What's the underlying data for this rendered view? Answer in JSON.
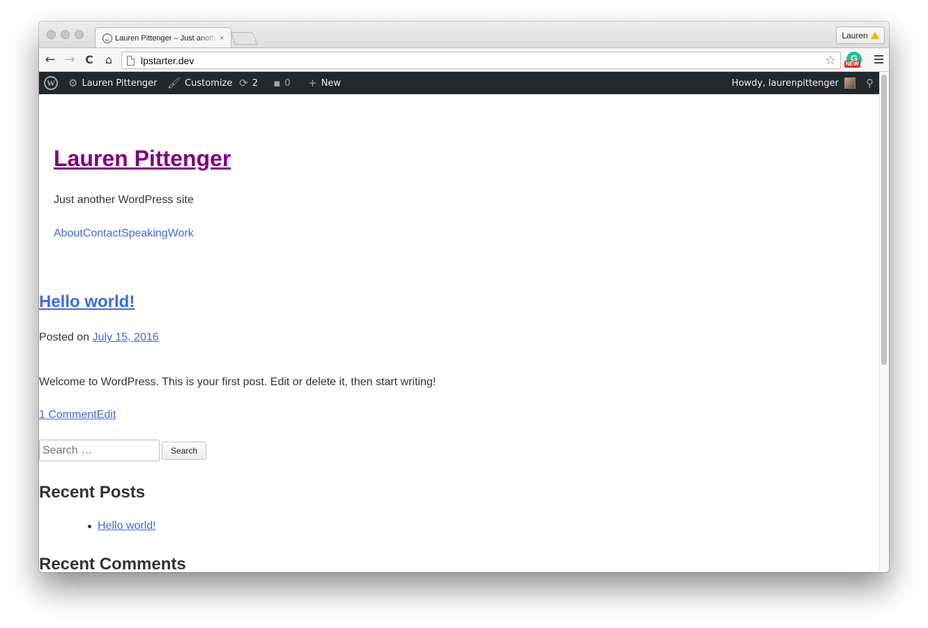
{
  "browser": {
    "tab_title": "Lauren Pittenger – Just another WordPress site",
    "tab_close": "×",
    "profile_name": "Lauren",
    "url": "lpstarter.dev",
    "extension_badge": "NEW",
    "nav": {
      "back": "←",
      "forward": "→",
      "reload": "C",
      "home": "⌂",
      "bookmark_star": "☆"
    }
  },
  "admin_bar": {
    "wp_logo": "W",
    "site_name": "Lauren Pittenger",
    "customize": "Customize",
    "updates_count": "2",
    "comments_count": "0",
    "new": "New",
    "howdy": "Howdy, laurenpittenger",
    "icons": {
      "site": "⚙",
      "customize": "🖌",
      "updates": "⟳",
      "comments": "▪",
      "new": "+",
      "search": "⚲"
    }
  },
  "site": {
    "title": "Lauren Pittenger",
    "description": "Just another WordPress site",
    "menu": [
      "About",
      "Contact",
      "Speaking",
      "Work"
    ]
  },
  "post": {
    "title": "Hello world!",
    "posted_prefix": "Posted on ",
    "date": "July 15, 2016",
    "body": "Welcome to WordPress. This is your first post. Edit or delete it, then start writing!",
    "comments_link": "1 Comment",
    "edit_link": "Edit"
  },
  "sidebar": {
    "search_placeholder": "Search …",
    "search_button": "Search",
    "recent_posts_title": "Recent Posts",
    "recent_posts": [
      "Hello world!"
    ],
    "recent_comments_title": "Recent Comments"
  },
  "colors": {
    "admin_bar_bg": "#23282d",
    "link": "#4169e1",
    "visited_link": "#800080",
    "text": "#333333"
  }
}
